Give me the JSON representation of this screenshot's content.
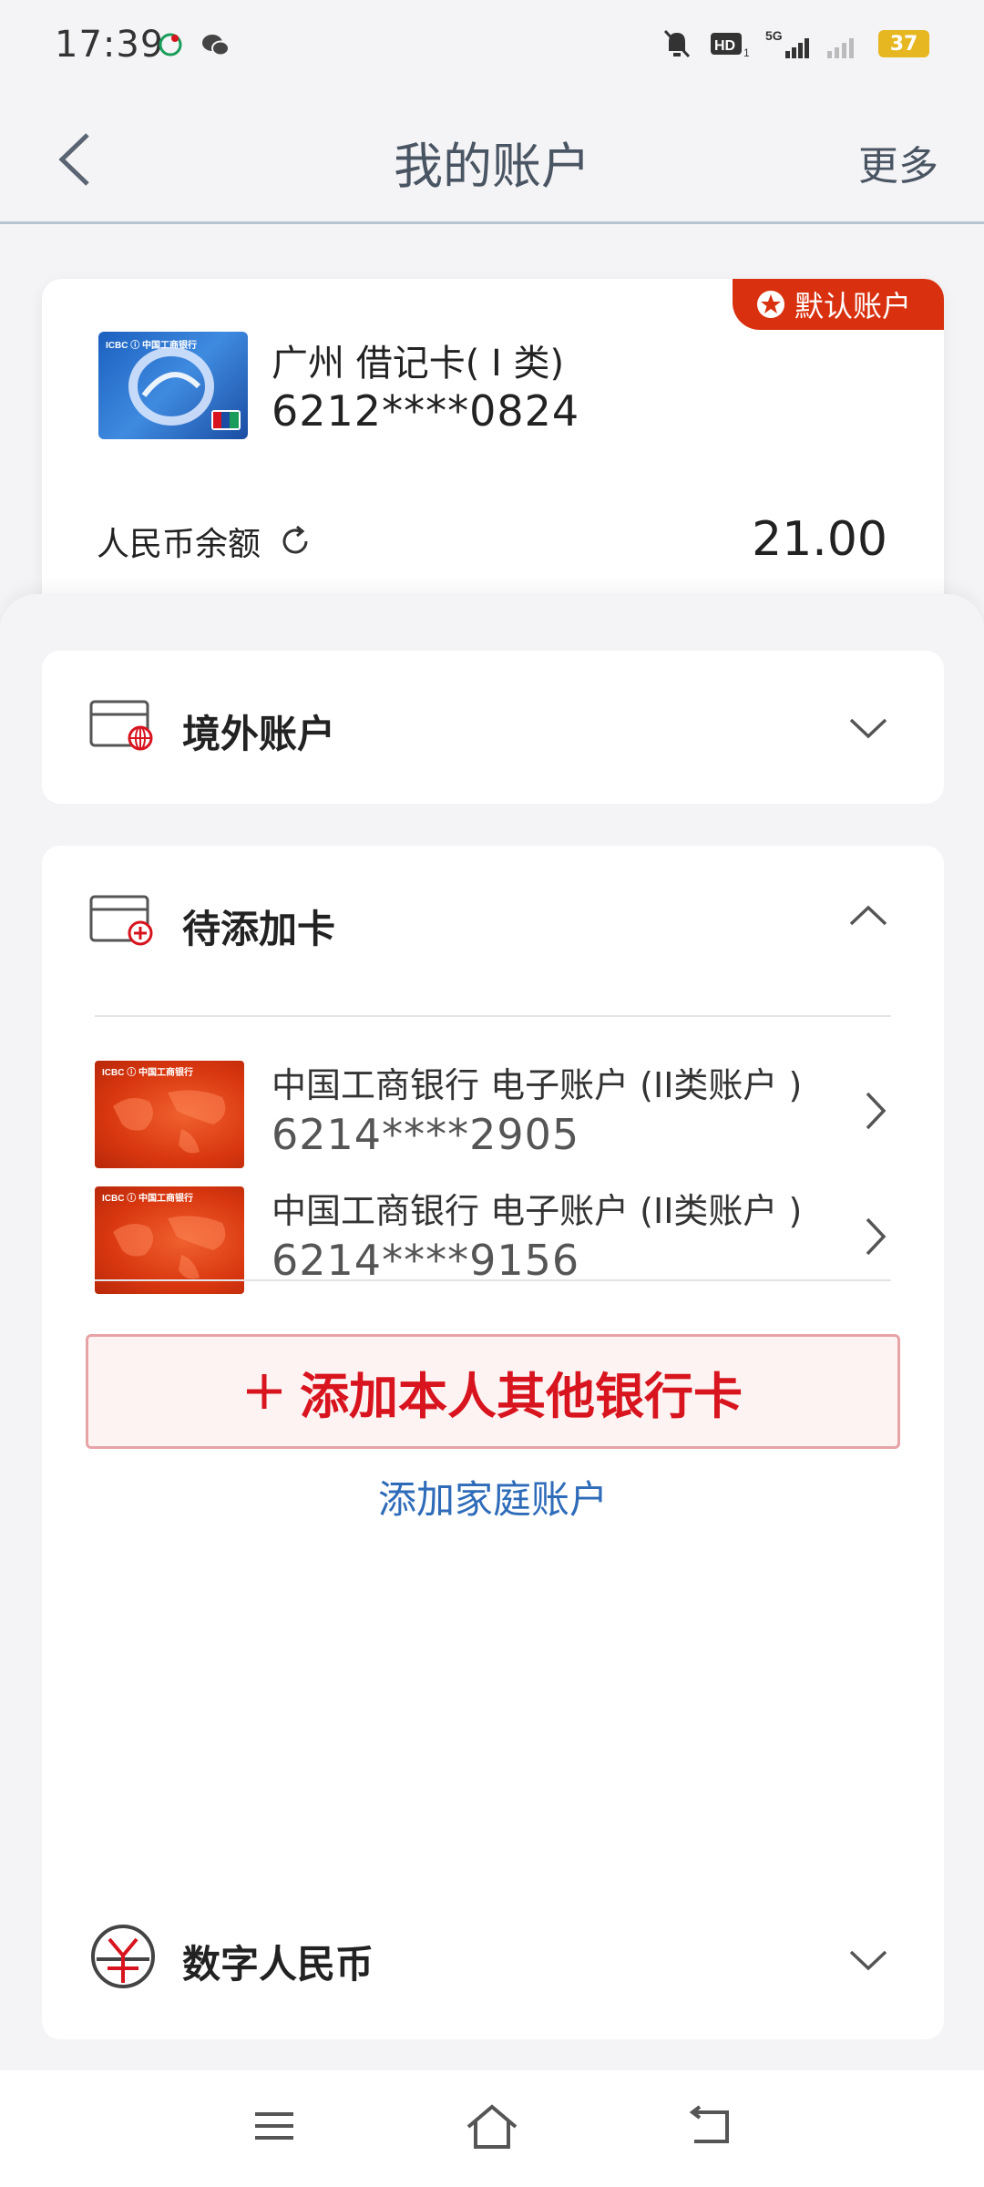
{
  "status_bar": {
    "time": "17:39",
    "battery": "37",
    "network": "5G"
  },
  "nav": {
    "title": "我的账户",
    "more": "更多"
  },
  "default_account": {
    "badge": "默认账户",
    "card_name": "广州 借记卡( Ⅰ 类)",
    "card_number": "6212****0824",
    "balance_label": "人民币余额",
    "balance": "21.00"
  },
  "sections": {
    "overseas": {
      "title": "境外账户"
    },
    "pending": {
      "title": "待添加卡",
      "cards": [
        {
          "name": "中国工商银行  电子账户 (II类账户 )",
          "number": "6214****2905"
        },
        {
          "name": "中国工商银行  电子账户 (II类账户 )",
          "number": "6214****9156"
        }
      ],
      "add_card": "添加本人其他银行卡",
      "add_family": "添加家庭账户"
    },
    "digital_rmb": {
      "title": "数字人民币"
    }
  },
  "colors": {
    "accent_red": "#d8141e",
    "badge_red": "#d9310f",
    "link_blue": "#2e6bb8"
  }
}
